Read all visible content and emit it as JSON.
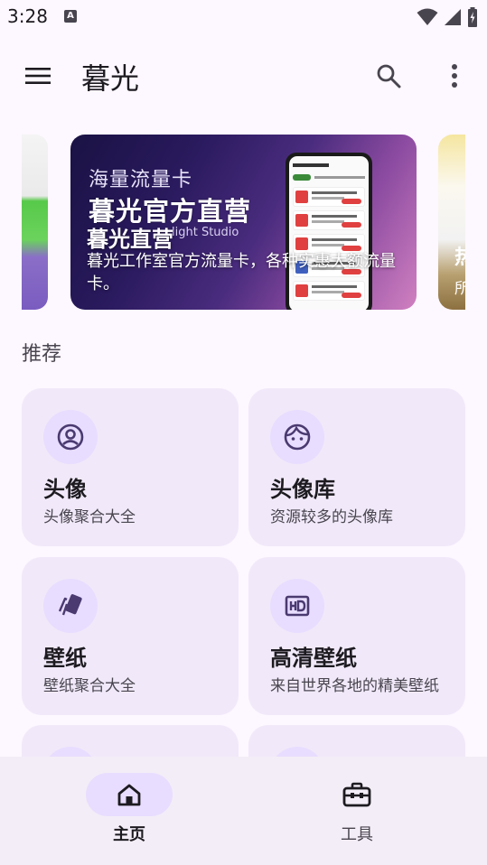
{
  "status_bar": {
    "time": "3:28",
    "notification_icon": "a-letter-icon",
    "icons": [
      "wifi-icon",
      "cell-signal-icon",
      "battery-icon"
    ]
  },
  "app_bar": {
    "title": "暮光",
    "menu_icon": "menu-icon",
    "search_icon": "search-icon",
    "more_icon": "more-vert-icon"
  },
  "carousel": {
    "current_banner": {
      "promo_subtitle": "海量流量卡",
      "promo_headline": "暮光官方直营",
      "promo_studio": "light Studio",
      "title": "暮光直营",
      "description": "暮光工作室官方流量卡，各种实惠大额流量卡。"
    },
    "next_banner_partial": {
      "title": "热",
      "subtitle": "所"
    }
  },
  "recommend": {
    "section_title": "推荐",
    "items": [
      {
        "title": "头像",
        "subtitle": "头像聚合大全",
        "icon": "account-circle-icon"
      },
      {
        "title": "头像库",
        "subtitle": "资源较多的头像库",
        "icon": "face-icon"
      },
      {
        "title": "壁纸",
        "subtitle": "壁纸聚合大全",
        "icon": "cards-wallpaper-icon"
      },
      {
        "title": "高清壁纸",
        "subtitle": "来自世界各地的精美壁纸",
        "icon": "hd-icon"
      }
    ]
  },
  "bottom_nav": {
    "items": [
      {
        "label": "主页",
        "icon": "home-icon",
        "selected": true
      },
      {
        "label": "工具",
        "icon": "toolbox-icon",
        "selected": false
      }
    ]
  },
  "colors": {
    "background": "#fdf7ff",
    "card": "#f1e9f9",
    "icon_container": "#e8ddff",
    "icon": "#4a3a70",
    "nav_background": "#f3edf7"
  }
}
